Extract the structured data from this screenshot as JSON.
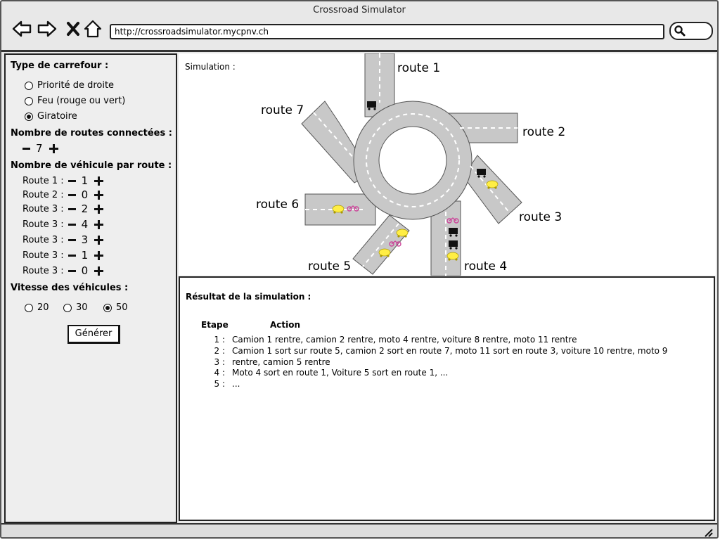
{
  "window": {
    "title": "Crossroad Simulator"
  },
  "toolbar": {
    "url": "http://crossroadsimulator.mycpnv.ch",
    "back_icon": "back-arrow-icon",
    "forward_icon": "forward-arrow-icon",
    "close_icon": "close-x-icon",
    "home_icon": "home-icon",
    "search_icon": "search-icon"
  },
  "sidebar": {
    "type_heading": "Type de carrefour :",
    "types": [
      {
        "label": "Priorité de droite",
        "selected": false
      },
      {
        "label": "Feu (rouge ou vert)",
        "selected": false
      },
      {
        "label": "Giratoire",
        "selected": true
      }
    ],
    "roads_heading": "Nombre de routes connectées :",
    "roads_count": "7",
    "vehicles_heading": "Nombre de véhicule par route :",
    "vehicles": [
      {
        "label": "Route 1 :",
        "value": "1"
      },
      {
        "label": "Route 2 :",
        "value": "0"
      },
      {
        "label": "Route 3 :",
        "value": "2"
      },
      {
        "label": "Route 3 :",
        "value": "4"
      },
      {
        "label": "Route 3 :",
        "value": "3"
      },
      {
        "label": "Route 3 :",
        "value": "1"
      },
      {
        "label": "Route 3 :",
        "value": "0"
      }
    ],
    "speed_heading": "Vitesse des véhicules :",
    "speeds": [
      {
        "label": "20",
        "selected": false
      },
      {
        "label": "30",
        "selected": false
      },
      {
        "label": "50",
        "selected": true
      }
    ],
    "generate_label": "Générer"
  },
  "simulation": {
    "label": "Simulation :",
    "routes": [
      "route 1",
      "route 2",
      "route 3",
      "route 4",
      "route 5",
      "route 6",
      "route 7"
    ],
    "colors": {
      "road": "#c8c8c8",
      "car": "#ffee44",
      "truck": "#111111",
      "moto": "#cc4499"
    }
  },
  "result": {
    "title": "Résultat de la simulation :",
    "col_step": "Etape",
    "col_action": "Action",
    "steps": [
      {
        "num": "1 :",
        "action": "Camion 1 rentre, camion 2 rentre, moto 4 rentre, voiture 8 rentre, moto 11 rentre"
      },
      {
        "num": "2 :",
        "action": "Camion 1 sort sur route 5, camion 2 sort en route 7, moto 11 sort en route 3, voiture 10 rentre, moto 9 rentre, camion 5 rentre"
      },
      {
        "num": "3 :",
        "action": ""
      },
      {
        "num": "4 :",
        "action": "Moto 4 sort en route 1, Voiture 5 sort en route 1, ..."
      },
      {
        "num": "5 :",
        "action": "..."
      }
    ]
  }
}
